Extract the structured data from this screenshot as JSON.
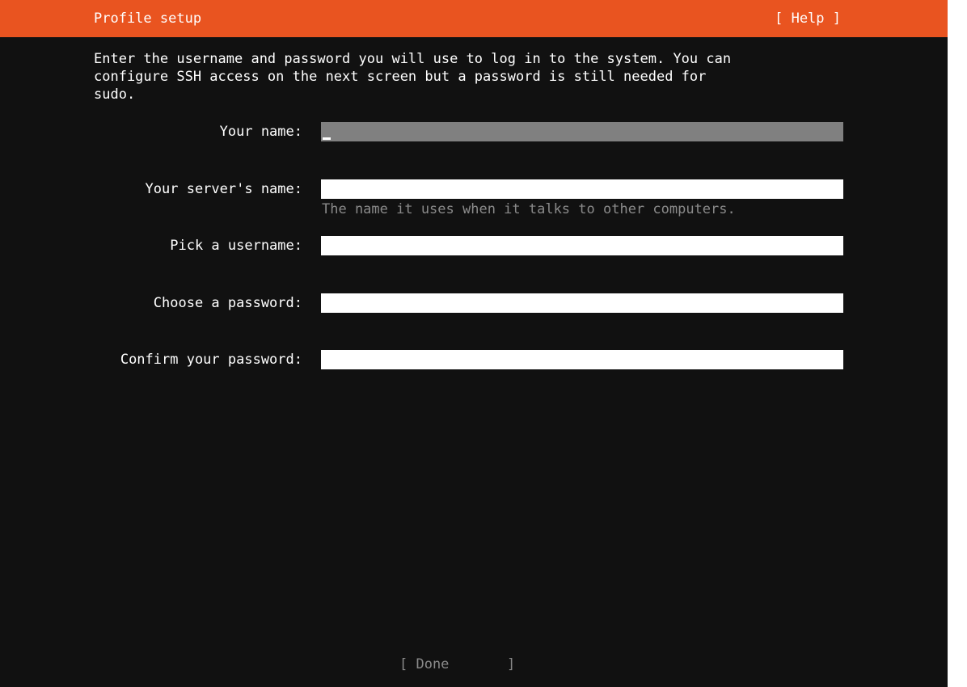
{
  "header": {
    "title": "Profile setup",
    "help_label": "[ Help ]"
  },
  "description": "Enter the username and password you will use to log in to the system. You can\nconfigure SSH access on the next screen but a password is still needed for\nsudo.",
  "fields": {
    "your_name": {
      "label": "Your name:",
      "value": ""
    },
    "server_name": {
      "label": "Your server's name:",
      "value": "",
      "help": "The name it uses when it talks to other computers."
    },
    "username": {
      "label": "Pick a username:",
      "value": ""
    },
    "password": {
      "label": "Choose a password:",
      "value": ""
    },
    "confirm_password": {
      "label": "Confirm your password:",
      "value": ""
    }
  },
  "done_label": "[ Done       ]",
  "colors": {
    "header_bg": "#e95420",
    "background": "#111111",
    "focused_field": "#808080",
    "field": "#ffffff",
    "muted_text": "#8a8a8a"
  }
}
